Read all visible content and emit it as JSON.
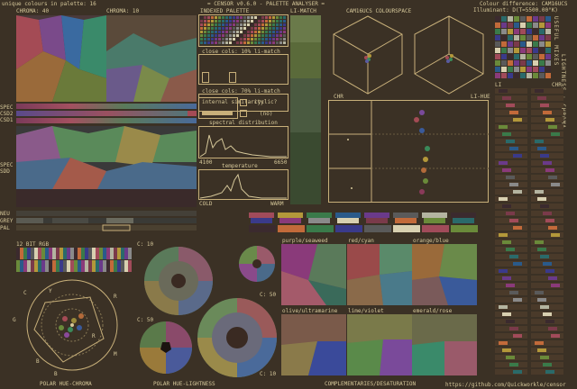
{
  "header": {
    "unique_colours": "unique colours in palette: 16",
    "app_title": "= CENSOR v0.6.0 - PALETTE ANALYSER =",
    "colour_difference": "Colour difference: CAM16UCS",
    "illuminant": "Illuminant: D(T=5500.00°K)"
  },
  "sections": {
    "chroma40": "CHROMA: 40",
    "chroma10": "CHROMA: 10",
    "indexed_palette": "INDEXED PALETTE",
    "li_match": "LI-MATCH",
    "colourspace": "CAM16UCS COLOURSPACE",
    "useful_mixes": "USEFUL MIXES",
    "lightness_chroma": "LIGHTNESS : CHROMA",
    "chr_left": "CHR",
    "li_hue": "LI-HUE",
    "li_right": "LI",
    "chr_right": "CHR",
    "close_cols_1": "close cols: 10% li-match",
    "close_cols_2": "close cols: 70% li-match",
    "internal_similarity": "internal similarity",
    "cyclic": "cyclic?",
    "cyclic_value": "(no)",
    "spectral_distribution": "spectral distribution",
    "spec_min": "4100",
    "spec_max": "6650",
    "temperature": "temperature",
    "cold": "COLD",
    "warm": "WARM",
    "spec_label": "SPEC",
    "csd2": "CSD2",
    "csd1": "CSD1",
    "spec_label2": "SPEC",
    "sdd": "SDD",
    "neu": "NEU",
    "grey": "GREY",
    "pal": "PAL",
    "bit_rgb": "12 BIT RGB",
    "c10": "C: 10",
    "c50a": "C: 50",
    "c50b": "C: 50",
    "c10b": "C: 10",
    "polar_hue_chroma": "POLAR HUE-CHROMA",
    "polar_hue_lightness": "POLAR HUE-LIGHTNESS",
    "complementaries": "COMPLEMENTARIES/DESATURATION",
    "url": "https://github.com/Quickworkle/censor"
  },
  "complementary_pairs": [
    "purple/seaweed",
    "red/cyan",
    "orange/blue",
    "olive/ultramarine",
    "lime/violet",
    "emerald/rose"
  ],
  "polar_labels": [
    "C",
    "Y",
    "R",
    "G",
    "B",
    "M",
    "R",
    "B"
  ],
  "colors": {
    "bg": "#3b3125",
    "panel": "#2a2119",
    "line": "#c8b07a",
    "text": "#d6c89a"
  },
  "palette": [
    "#3b2a2e",
    "#7a3a4a",
    "#a14b5a",
    "#c26a3a",
    "#b3983a",
    "#6a8a3a",
    "#3a7a4a",
    "#2a6a6a",
    "#2a5a8a",
    "#3a3a8a",
    "#6a3a8a",
    "#8a3a7a",
    "#5a5a5a",
    "#8a8a8a",
    "#b4b4a0",
    "#d8d0b0"
  ]
}
